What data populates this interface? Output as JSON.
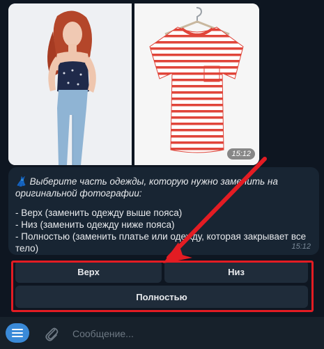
{
  "images": {
    "left_alt": "woman-in-jeans-and-top",
    "right_alt": "red-striped-tshirt",
    "time": "15:12"
  },
  "message": {
    "emoji": "👗",
    "lines": [
      "Выберите часть одежды, которую нужно заменить на",
      "оригинальной фотографии:",
      "",
      "- Верх (заменить одежду выше пояса)",
      "- Низ (заменить одежду ниже пояса)",
      "- Полностью (заменить платье или одежду, которая закрывает все",
      "тело)"
    ],
    "time": "15:12"
  },
  "keyboard": {
    "top": "Верх",
    "bottom": "Низ",
    "full": "Полностью"
  },
  "composer": {
    "placeholder": "Сообщение..."
  },
  "colors": {
    "bg": "#0e1621",
    "bubble": "#182533",
    "button": "#1f2c3a",
    "annotation": "#e31c23",
    "accent": "#3a8ad8"
  }
}
